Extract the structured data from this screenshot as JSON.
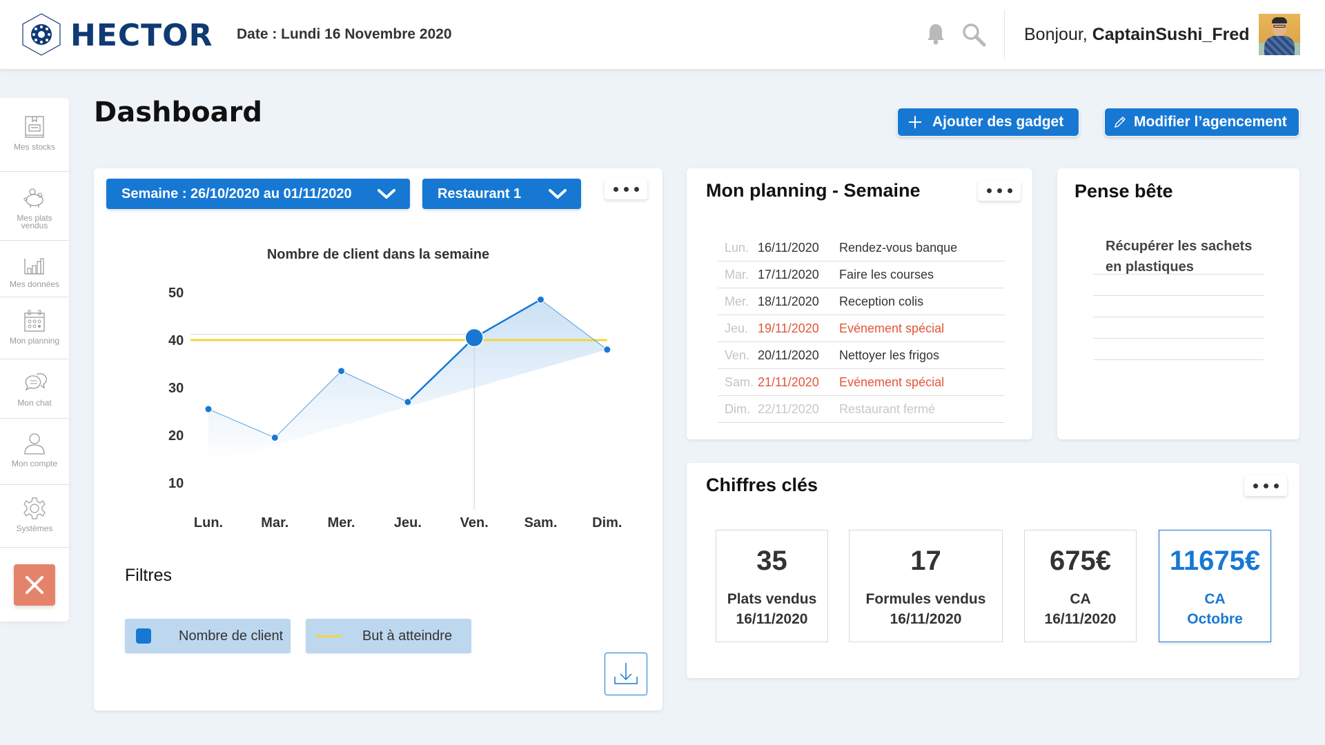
{
  "header": {
    "brand": "HECTOR",
    "date": "Date : Lundi 16 Novembre 2020",
    "greeting_prefix": "Bonjour, ",
    "username": "CaptainSushi_Fred",
    "icons": {
      "notification": "bell-icon",
      "search": "search-icon"
    }
  },
  "sidebar": {
    "items": [
      {
        "label": "Mes stocks",
        "icon": "box-icon"
      },
      {
        "label": "Mes plats vendus",
        "icon": "piggy-bank-icon"
      },
      {
        "label": "Mes données",
        "icon": "bar-chart-icon"
      },
      {
        "label": "Mon planning",
        "icon": "calendar-icon"
      },
      {
        "label": "Mon chat",
        "icon": "chat-icon"
      },
      {
        "label": "Mon compte",
        "icon": "user-icon"
      },
      {
        "label": "Systèmes",
        "icon": "gear-icon"
      }
    ],
    "close_icon": "close-icon"
  },
  "page": {
    "title": "Dashboard",
    "add_gadget_label": "Ajouter des gadget",
    "edit_layout_label": "Modifier l’agencement"
  },
  "chart_card": {
    "week_select": "Semaine : 26/10/2020 au 01/11/2020",
    "restaurant_select": "Restaurant 1",
    "filters_title": "Filtres",
    "legend": [
      {
        "label": "Nombre de client",
        "color": "#1778d4"
      },
      {
        "label": "But à atteindre",
        "color": "#f4d53a"
      }
    ]
  },
  "chart_data": {
    "type": "line",
    "title": "Nombre de client dans la semaine",
    "xlabel": "",
    "ylabel": "",
    "categories": [
      "Lun.",
      "Mar.",
      "Mer.",
      "Jeu.",
      "Ven.",
      "Sam.",
      "Dim."
    ],
    "series": [
      {
        "name": "Nombre de client",
        "values": [
          25.5,
          19.5,
          33.5,
          27,
          40.5,
          48.5,
          38
        ],
        "color": "#1778d4"
      },
      {
        "name": "But à atteindre",
        "values": [
          40,
          40,
          40,
          40,
          40,
          40,
          40
        ],
        "color": "#f4d53a"
      }
    ],
    "yticks": [
      10,
      20,
      30,
      40,
      50
    ],
    "ylim": [
      5,
      52
    ],
    "highlighted_index": 4,
    "grid": false,
    "legend": "bottom"
  },
  "planning": {
    "title": "Mon planning - Semaine",
    "rows": [
      {
        "day": "Lun.",
        "date": "16/11/2020",
        "task": "Rendez-vous banque",
        "status": "normal"
      },
      {
        "day": "Mar.",
        "date": "17/11/2020",
        "task": "Faire les courses",
        "status": "normal"
      },
      {
        "day": "Mer.",
        "date": "18/11/2020",
        "task": "Reception colis",
        "status": "normal"
      },
      {
        "day": "Jeu.",
        "date": "19/11/2020",
        "task": "Evénement spécial",
        "status": "special"
      },
      {
        "day": "Ven.",
        "date": "20/11/2020",
        "task": "Nettoyer les frigos",
        "status": "normal"
      },
      {
        "day": "Sam.",
        "date": "21/11/2020",
        "task": "Evénement spécial",
        "status": "special"
      },
      {
        "day": "Dim.",
        "date": "22/11/2020",
        "task": "Restaurant fermé",
        "status": "closed"
      }
    ]
  },
  "notes": {
    "title": "Pense bête",
    "text": "Récupérer les sachets en plastiques"
  },
  "kpis": {
    "title": "Chiffres clés",
    "items": [
      {
        "value": "35",
        "label": "Plats vendus",
        "sub": "16/11/2020"
      },
      {
        "value": "17",
        "label": "Formules vendus",
        "sub": "16/11/2020"
      },
      {
        "value": "675€",
        "label": "CA",
        "sub": "16/11/2020"
      },
      {
        "value": "11675€",
        "label": "CA",
        "sub": "Octobre"
      }
    ]
  },
  "colors": {
    "primary": "#1778d4",
    "brand": "#0f3a73",
    "danger": "#e5836a",
    "special": "#e1553a",
    "goal": "#f4d53a"
  }
}
